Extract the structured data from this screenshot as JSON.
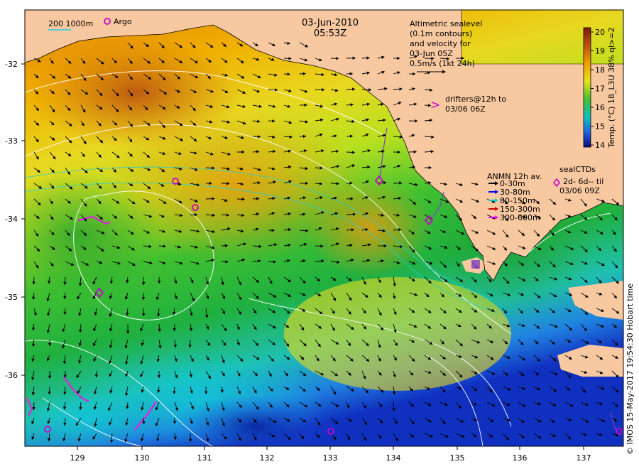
{
  "header": {
    "date": "03-Jun-2010",
    "time": "05:53Z"
  },
  "scale_bar": {
    "label": "200  1000m"
  },
  "argo_label": "Argo",
  "altimetry_note": {
    "lines": [
      "Altimetric sealevel",
      "(0.1m contours)",
      "and velocity for",
      "03-Jun 05Z"
    ],
    "velocity_scale": "0.5m/s (1kt 24h)"
  },
  "drifters_note": {
    "symbol": ">",
    "line1": "drifters@12h to",
    "line2": "03/06 06Z"
  },
  "anmn_legend": {
    "title": "ANMN 12h av.",
    "items": [
      {
        "label": "0-30m",
        "color": "#000000"
      },
      {
        "label": "30-80m",
        "color": "#0000ff"
      },
      {
        "label": "80-150m",
        "color": "#00d0d0"
      },
      {
        "label": "150-300m",
        "color": "#cc0000"
      },
      {
        "label": "300-600m",
        "color": "#ff00ff"
      }
    ]
  },
  "sealctd_legend": {
    "title": "sealCTDs",
    "line1": "2d- 6d-- til",
    "line2": "03/06 09Z"
  },
  "colorbar": {
    "label": "Temp. (°C) 18_L3U 38% ql>=2",
    "ticks": [
      "20",
      "19",
      "18",
      "17",
      "16",
      "15",
      "14"
    ],
    "min": 14,
    "max": 20
  },
  "axes": {
    "lat_ticks": [
      "-32",
      "-33",
      "-34",
      "-35",
      "-36"
    ],
    "lon_ticks": [
      "129",
      "130",
      "131",
      "132",
      "133",
      "134",
      "135",
      "136",
      "137"
    ]
  },
  "credit": "© IMOS 15-May-2017 19:54:30 Hobart time",
  "colors": {
    "land": "#f8c8a0",
    "argo": "#cc00cc",
    "contour": "#ffffff",
    "arrow": "#000000"
  }
}
